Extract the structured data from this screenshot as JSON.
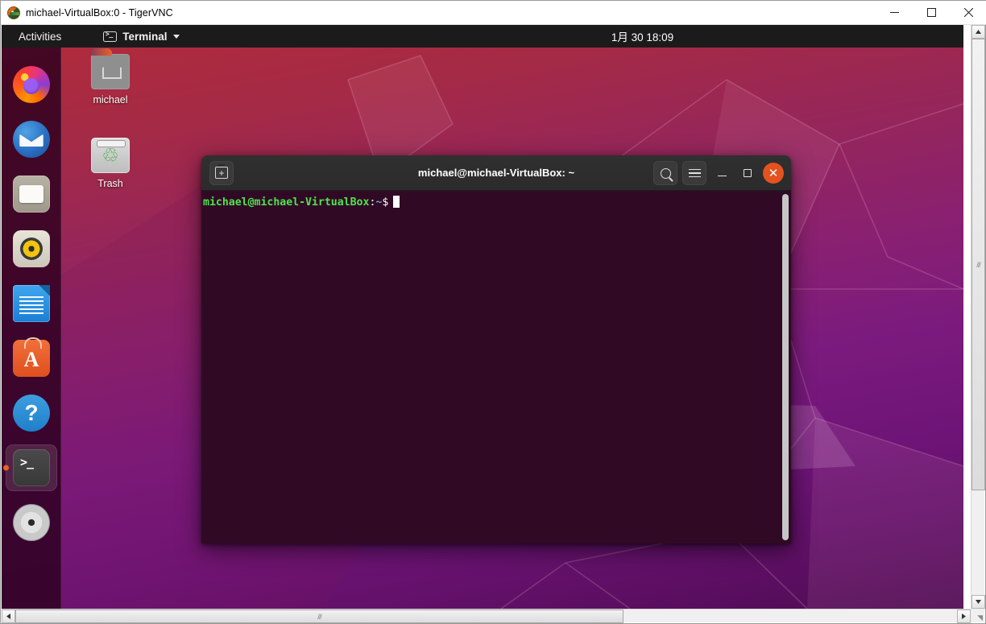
{
  "vnc_window": {
    "title": "michael-VirtualBox:0 - TigerVNC",
    "app_icon": "tigervnc-icon",
    "controls": {
      "minimize": "—",
      "maximize": "□",
      "close": "✕"
    }
  },
  "gnome_topbar": {
    "activities": "Activities",
    "app_menu": "Terminal",
    "clock": "1月 30  18:09"
  },
  "dock": {
    "items": [
      {
        "name": "firefox",
        "label": "Firefox",
        "running": false
      },
      {
        "name": "thunderbird",
        "label": "Thunderbird Mail",
        "running": false
      },
      {
        "name": "files",
        "label": "Files",
        "running": false
      },
      {
        "name": "rhythmbox",
        "label": "Rhythmbox",
        "running": false
      },
      {
        "name": "libreoffice-writer",
        "label": "LibreOffice Writer",
        "running": false
      },
      {
        "name": "ubuntu-software",
        "label": "Ubuntu Software",
        "running": false
      },
      {
        "name": "help",
        "label": "Help",
        "running": false
      },
      {
        "name": "terminal",
        "label": "Terminal",
        "running": true
      },
      {
        "name": "install-ubuntu",
        "label": "Install Ubuntu",
        "running": false
      }
    ]
  },
  "desktop_icons": [
    {
      "name": "home-folder",
      "label": "michael"
    },
    {
      "name": "trash",
      "label": "Trash"
    }
  ],
  "terminal": {
    "title": "michael@michael-VirtualBox: ~",
    "buttons": {
      "new_tab": "new-tab-icon",
      "search": "search-icon",
      "menu": "hamburger-menu-icon",
      "minimize": "minimize-icon",
      "maximize": "maximize-icon",
      "close": "✕"
    },
    "prompt": {
      "user_host": "michael@michael-VirtualBox",
      "colon": ":",
      "path": "~",
      "sigil": "$"
    }
  },
  "scrollbars": {
    "vertical": {
      "up": "▲",
      "down": "▼",
      "grip": "///"
    },
    "horizontal": {
      "left": "◀",
      "right": "▶",
      "grip": "///"
    }
  },
  "colors": {
    "terminal_bg": "#300a24",
    "terminal_titlebar": "#2b2b2b",
    "close_button": "#e4521f",
    "prompt_green": "#4ee44e",
    "prompt_blue": "#729fcf",
    "topbar_bg": "#1b1b1b",
    "dock_bg": "#2c001e",
    "running_dot": "#e8622a"
  }
}
